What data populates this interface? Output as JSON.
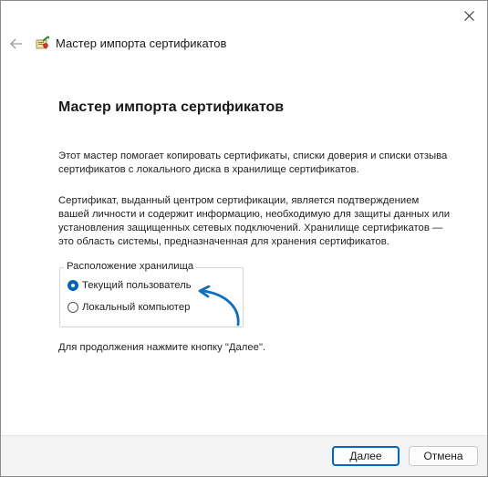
{
  "window": {
    "close_icon": "close-icon",
    "back_icon": "back-arrow-icon",
    "app_icon": "certificate-icon",
    "title": "Мастер импорта сертификатов"
  },
  "content": {
    "heading": "Мастер импорта сертификатов",
    "paragraph1": "Этот мастер помогает копировать сертификаты, списки доверия и списки отзыва сертификатов с локального диска в хранилище сертификатов.",
    "paragraph2": "Сертификат, выданный центром сертификации, является подтверждением вашей личности и содержит информацию, необходимую для защиты данных или установления защищенных сетевых подключений. Хранилище сертификатов — это область системы, предназначенная для хранения сертификатов.",
    "store_group": {
      "label": "Расположение хранилища",
      "options": [
        {
          "label": "Текущий пользователь",
          "selected": true
        },
        {
          "label": "Локальный компьютер",
          "selected": false
        }
      ]
    },
    "arrow_color": "#0a6fc2",
    "continue_note": "Для продолжения нажмите кнопку \"Далее\"."
  },
  "footer": {
    "next_label": "Далее",
    "cancel_label": "Отмена"
  },
  "colors": {
    "accent": "#0067c0"
  }
}
